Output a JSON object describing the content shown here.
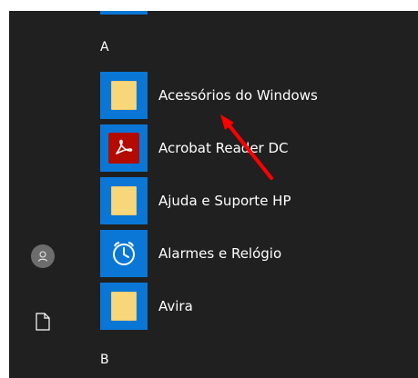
{
  "start_menu": {
    "rail": {
      "account_icon": "user-avatar-icon",
      "documents_icon": "document-icon"
    },
    "sections": [
      {
        "letter": "A",
        "apps": [
          {
            "label": "Acessórios do Windows",
            "icon": "folder-icon"
          },
          {
            "label": "Acrobat Reader DC",
            "icon": "acrobat-reader-icon"
          },
          {
            "label": "Ajuda e Suporte HP",
            "icon": "folder-icon"
          },
          {
            "label": "Alarmes e Relógio",
            "icon": "alarm-clock-icon"
          },
          {
            "label": "Avira",
            "icon": "folder-icon"
          }
        ]
      },
      {
        "letter": "B",
        "apps": []
      }
    ],
    "annotation": {
      "type": "arrow",
      "color": "#ff0000",
      "target": "Acessórios do Windows"
    },
    "colors": {
      "background": "#202020",
      "tile": "#0a77d6",
      "folder": "#f7d77a",
      "acrobat": "#b30b00",
      "text": "#ffffff"
    }
  }
}
